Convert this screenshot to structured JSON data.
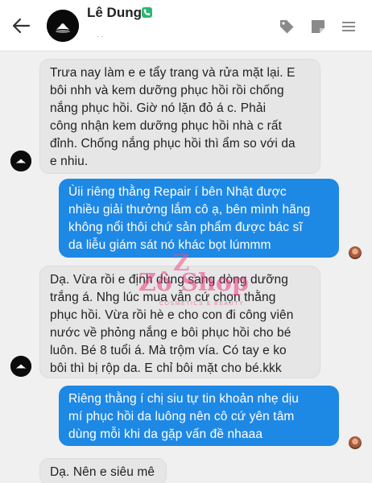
{
  "contact": {
    "name": "Lê Dung",
    "status": ". ."
  },
  "icons": {
    "back": "back-arrow-icon",
    "phone_badge": "phone-icon",
    "tag": "tag-icon",
    "note": "note-icon",
    "menu": "menu-icon"
  },
  "colors": {
    "outgoing_bubble": "#1e88e5",
    "incoming_bubble": "#e6e6e6",
    "chat_background": "#f0f0f0"
  },
  "watermark": {
    "letter": "Z",
    "brand": "Zô Shop",
    "tagline": "COSMETICS & BEAUTY"
  },
  "messages": [
    {
      "direction": "incoming",
      "lines": [
        "Trưa nay làm e e tẩy trang và rửa mặt lại. E",
        "bôi nhh và kem dưỡng phục hồi rồi chống",
        "nắng phục hồi. Giờ nó lặn đỏ á c. Phải",
        "công nhận kem dưỡng phục hồi nhà c rất",
        "đỉnh. Chống nắng phục hồi thì ẩm so với da",
        "e nhiu."
      ]
    },
    {
      "direction": "outgoing",
      "lines": [
        "Ùii riêng thằng Repair í bên Nhật được",
        "nhiều giải thưởng lắm cô ạ, bên mình hãng",
        "không nổi thôi chứ sản phẩm được bác sĩ",
        "da liễu giám sát nó khác bọt lúmmm"
      ]
    },
    {
      "direction": "incoming",
      "lines": [
        "Dạ. Vừa rồi e định dùng sang dòng dưỡng",
        "trắng á. Nhg lúc mua vẫn cứ chọn thằng",
        "phục hồi. Vừa rồi hè e cho con đi công viên",
        "nước về phỏng nắng e bôi phục hồi cho bé",
        "luôn. Bé 8 tuổi á. Mà trộm vía. Có tay e ko",
        "bôi thì bị rộp da. E chỉ bôi mặt cho bé.kkk"
      ]
    },
    {
      "direction": "outgoing",
      "lines": [
        "Riêng thằng í chị siu tự tin khoản nhẹ dịu",
        "mí phục hồi da luông nên cô cứ yên tâm",
        "dùng mỗi khi da gặp vấn đề nhaaa"
      ]
    },
    {
      "direction": "incoming",
      "lines": [
        "Dạ. Nên e siêu mê"
      ]
    }
  ]
}
